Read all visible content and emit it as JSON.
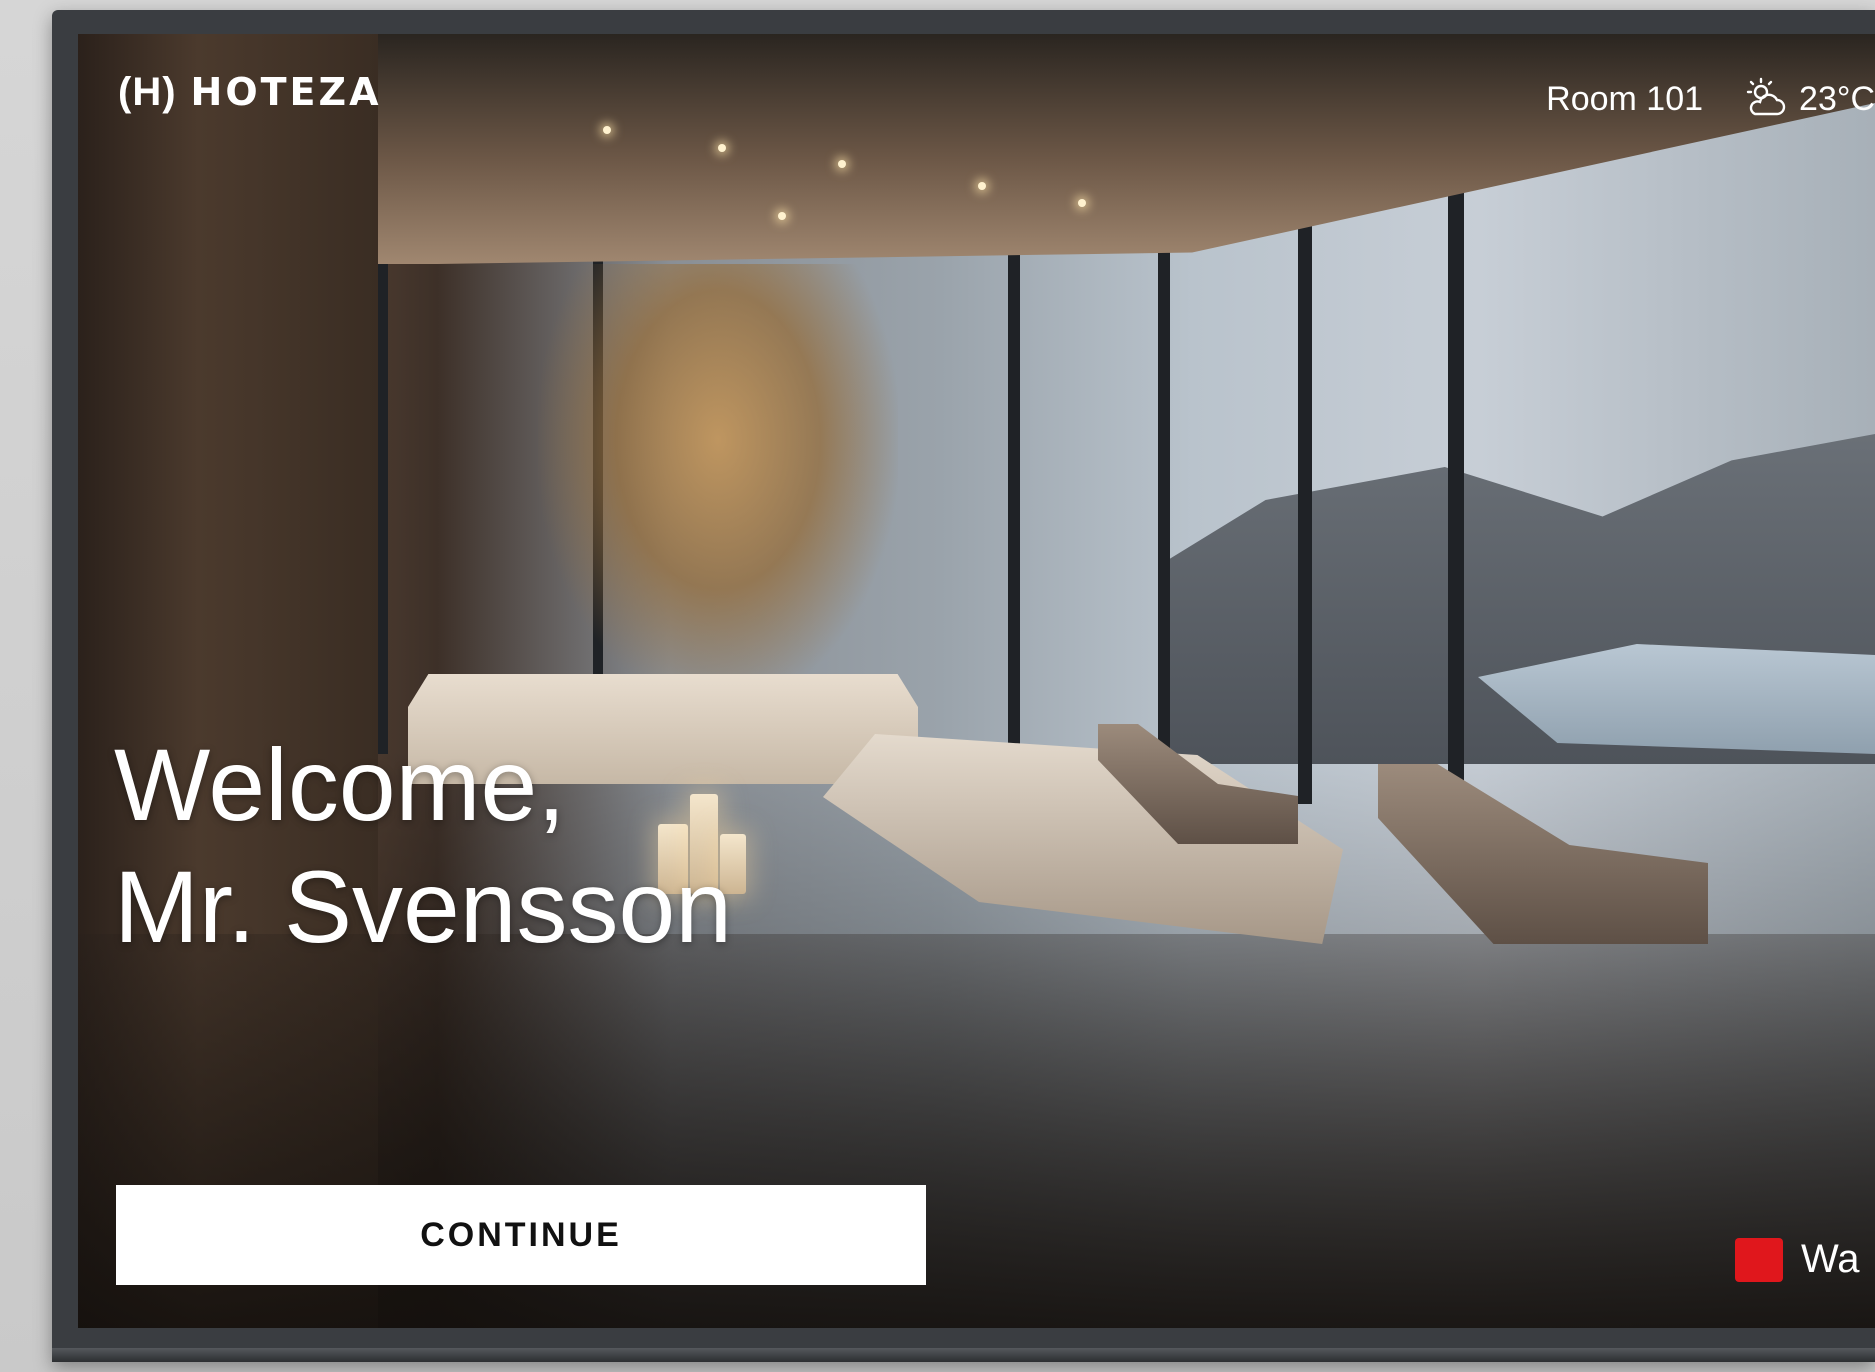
{
  "brand": {
    "logo_mark": "(H)",
    "name": "HOTEZA"
  },
  "status_bar": {
    "room_label": "Room 101",
    "weather_icon": "partly-cloudy-icon",
    "temperature": "23°C"
  },
  "welcome": {
    "line1": "Welcome,",
    "line2": "Mr. Svensson"
  },
  "continue_button": {
    "label": "CONTINUE"
  },
  "red_key_hint": {
    "key_color": "#e0171c",
    "label": "Wa"
  }
}
